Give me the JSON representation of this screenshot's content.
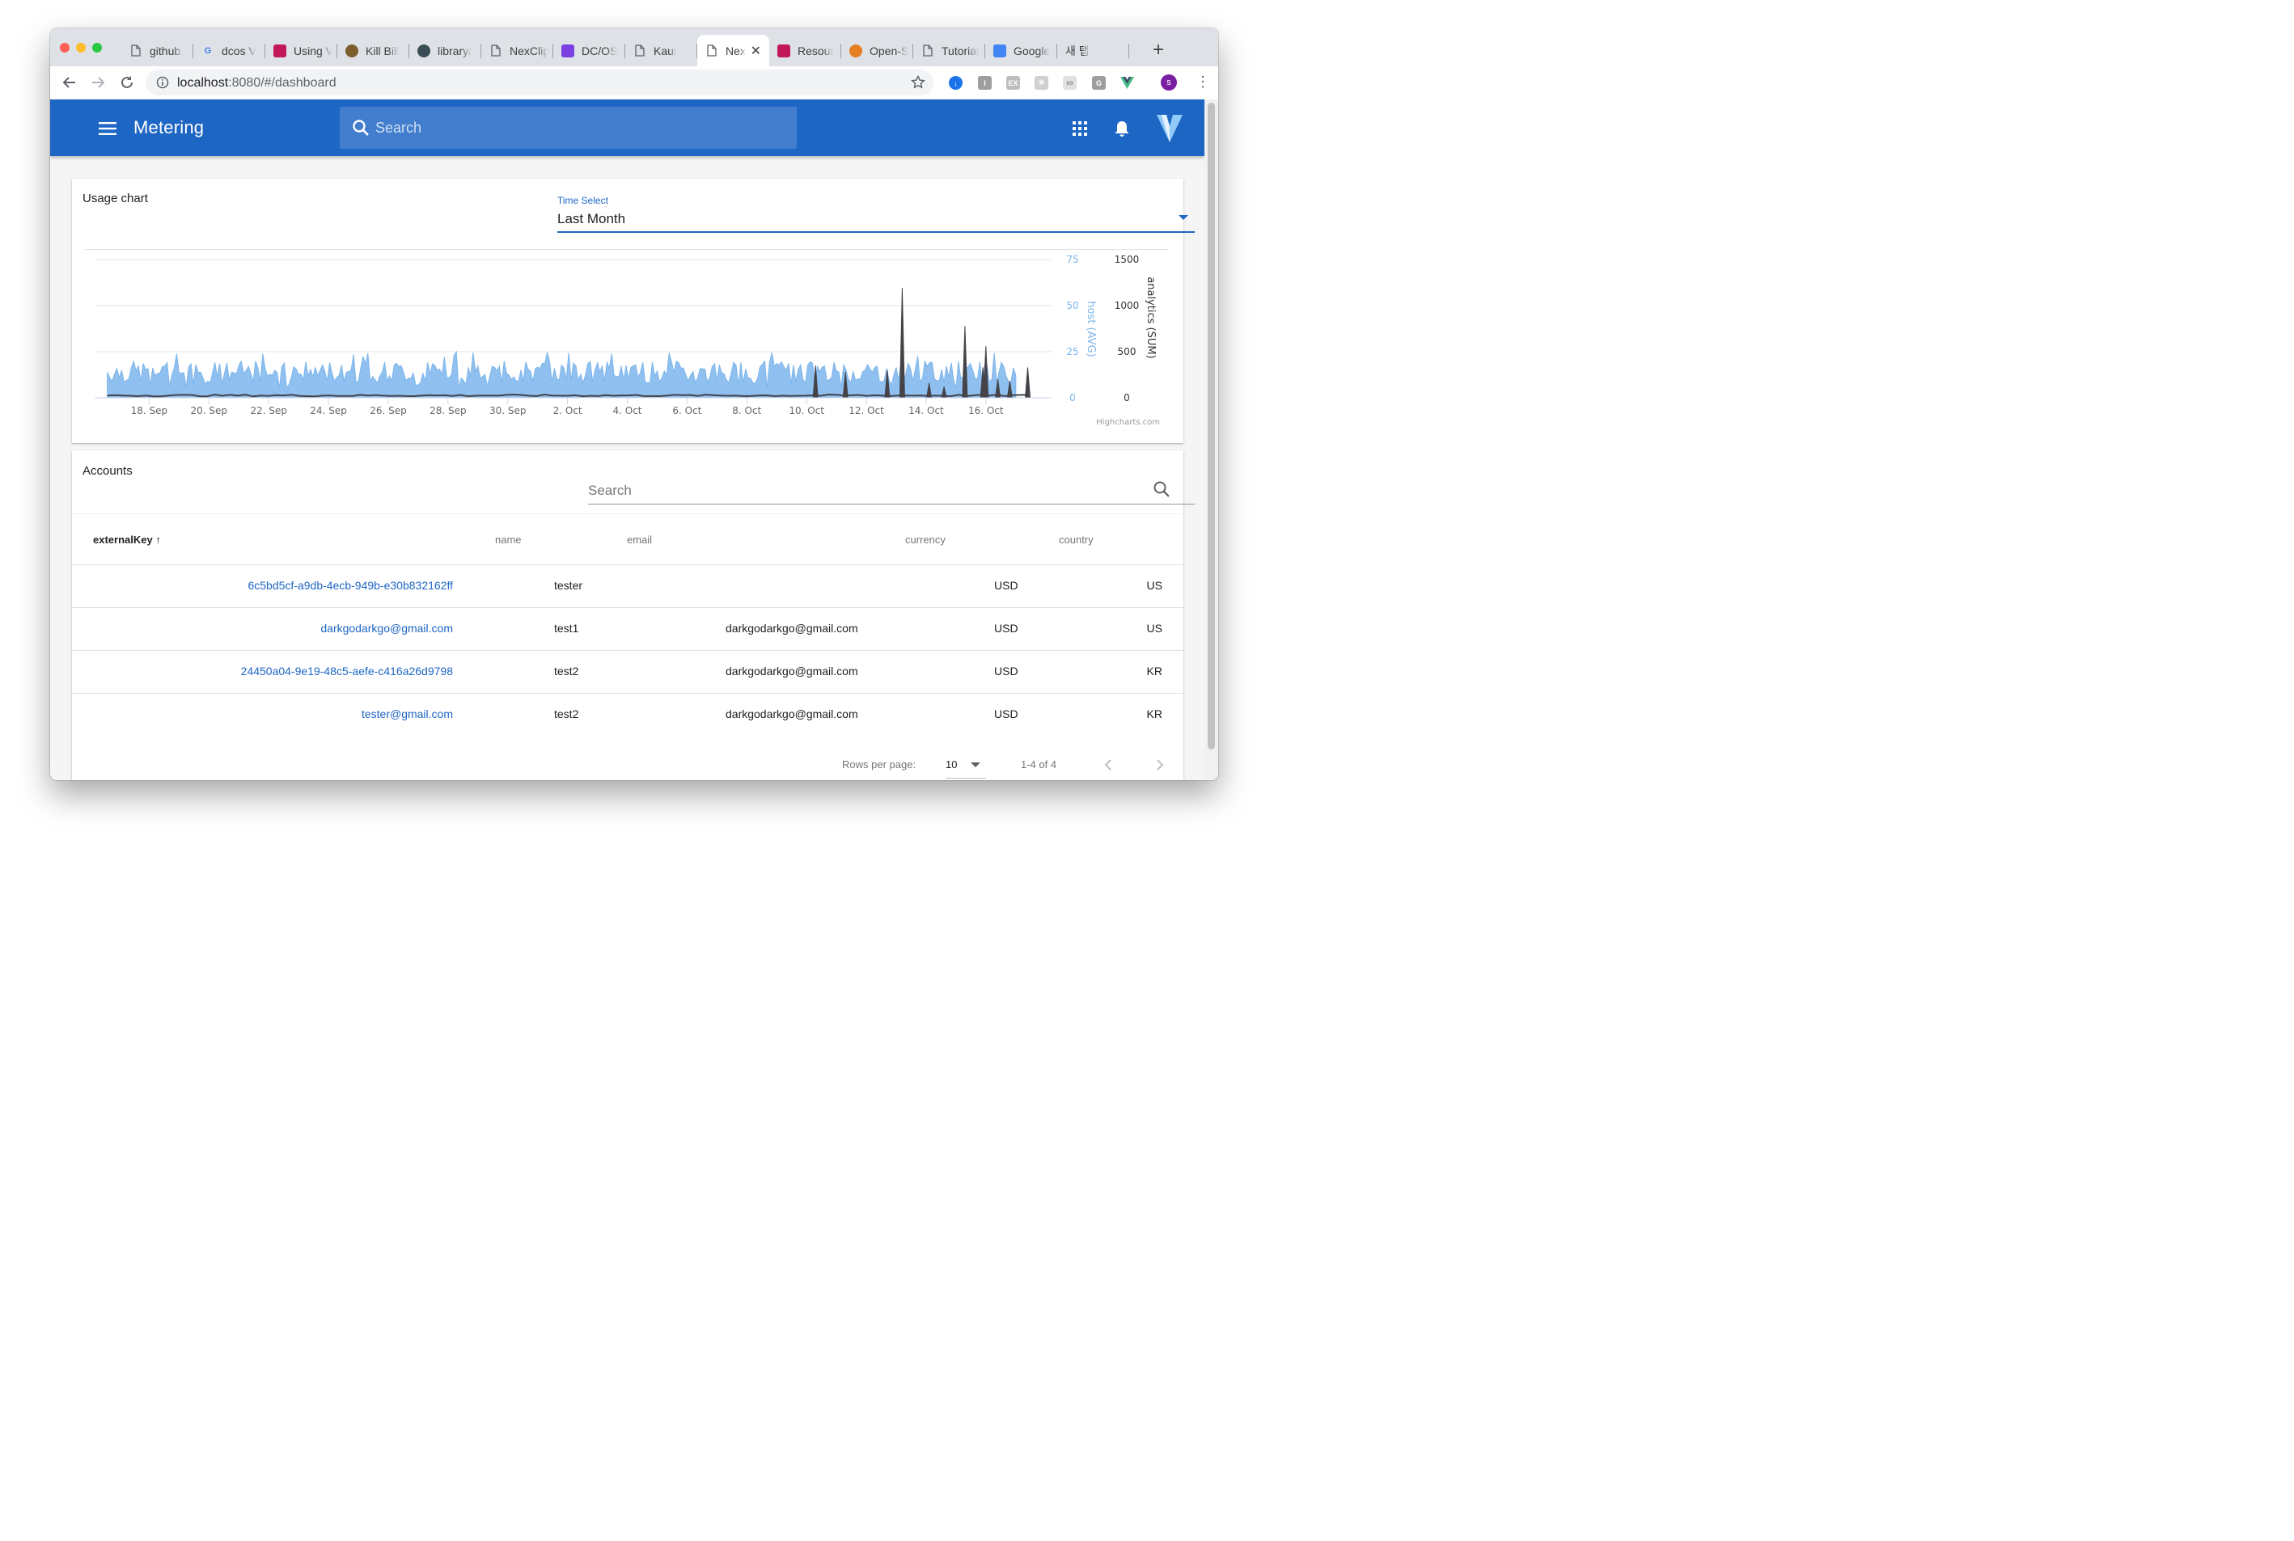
{
  "browser": {
    "tabs": [
      {
        "label": "github.",
        "icon": "doc-icon",
        "color": "#5f6368"
      },
      {
        "label": "dcos V",
        "icon": "google-icon",
        "color": "#4285f4"
      },
      {
        "label": "Using V",
        "icon": "app-icon",
        "color": "#c2185b"
      },
      {
        "label": "Kill Bill",
        "icon": "killbill-icon",
        "color": "#7b5e2b"
      },
      {
        "label": "library/",
        "icon": "docker-icon",
        "color": "#394d54"
      },
      {
        "label": "NexClip",
        "icon": "doc-icon",
        "color": "#5f6368"
      },
      {
        "label": "DC/OS",
        "icon": "dcos-icon",
        "color": "#7b3fe4"
      },
      {
        "label": "Kaui",
        "icon": "doc-icon",
        "color": "#5f6368"
      },
      {
        "label": "Nex",
        "icon": "doc-icon",
        "color": "#5f6368",
        "active": true
      },
      {
        "label": "Resour",
        "icon": "app-icon",
        "color": "#c2185b"
      },
      {
        "label": "Open-S",
        "icon": "globe-icon",
        "color": "#e67e22"
      },
      {
        "label": "Tutorial",
        "icon": "doc-icon",
        "color": "#5f6368"
      },
      {
        "label": "Google",
        "icon": "translate-icon",
        "color": "#4285f4"
      },
      {
        "label": "새 탭",
        "icon": "",
        "color": ""
      }
    ],
    "url_host": "localhost",
    "url_rest": ":8080/#/dashboard",
    "profile_initial": "s"
  },
  "appbar": {
    "title": "Metering",
    "search_placeholder": "Search"
  },
  "usage": {
    "title": "Usage chart",
    "select_label": "Time Select",
    "select_value": "Last Month",
    "credit": "Highcharts.com"
  },
  "chart_data": {
    "type": "area",
    "x_ticks": [
      "18. Sep",
      "20. Sep",
      "22. Sep",
      "24. Sep",
      "26. Sep",
      "28. Sep",
      "30. Sep",
      "2. Oct",
      "4. Oct",
      "6. Oct",
      "8. Oct",
      "10. Oct",
      "12. Oct",
      "14. Oct",
      "16. Oct"
    ],
    "x_range_days": [
      16.5,
      47.9
    ],
    "y_axes": [
      {
        "title": "host (AVG)",
        "ticks": [
          "75",
          "50",
          "25",
          "0"
        ],
        "range": [
          0,
          75
        ],
        "color": "#7cb5ec"
      },
      {
        "title": "analytics (SUM)",
        "ticks": [
          "1500",
          "1000",
          "500",
          "0"
        ],
        "range": [
          0,
          1500
        ],
        "color": "#434348"
      }
    ],
    "series": [
      {
        "name": "host (AVG)",
        "type": "area",
        "axis": 0,
        "color": "#7cb5ec",
        "typical_range": [
          8,
          20
        ],
        "max": 25
      },
      {
        "name": "analytics (SUM)",
        "type": "line",
        "axis": 1,
        "color": "#434348",
        "baseline": 25,
        "spikes": [
          {
            "day": 40.3,
            "value": 350
          },
          {
            "day": 41.3,
            "value": 280
          },
          {
            "day": 42.7,
            "value": 300
          },
          {
            "day": 43.2,
            "value": 1190
          },
          {
            "day": 44.1,
            "value": 160
          },
          {
            "day": 44.6,
            "value": 120
          },
          {
            "day": 45.3,
            "value": 780
          },
          {
            "day": 45.9,
            "value": 330
          },
          {
            "day": 46.0,
            "value": 560
          },
          {
            "day": 46.4,
            "value": 200
          },
          {
            "day": 46.8,
            "value": 180
          },
          {
            "day": 47.4,
            "value": 330
          }
        ]
      }
    ]
  },
  "accounts": {
    "title": "Accounts",
    "search_placeholder": "Search",
    "columns": {
      "externalKey": "externalKey",
      "name": "name",
      "email": "email",
      "currency": "currency",
      "country": "country"
    },
    "rows": [
      {
        "externalKey": "6c5bd5cf-a9db-4ecb-949b-e30b832162ff",
        "name": "tester",
        "email": "",
        "currency": "USD",
        "country": "US"
      },
      {
        "externalKey": "darkgodarkgo@gmail.com",
        "name": "test1",
        "email": "darkgodarkgo@gmail.com",
        "currency": "USD",
        "country": "US"
      },
      {
        "externalKey": "24450a04-9e19-48c5-aefe-c416a26d9798",
        "name": "test2",
        "email": "darkgodarkgo@gmail.com",
        "currency": "USD",
        "country": "KR"
      },
      {
        "externalKey": "tester@gmail.com",
        "name": "test2",
        "email": "darkgodarkgo@gmail.com",
        "currency": "USD",
        "country": "KR"
      }
    ],
    "rows_per_page_label": "Rows per page:",
    "rows_per_page_value": "10",
    "page_info": "1-4 of 4"
  },
  "colors": {
    "primary": "#1e66c4",
    "host_series": "#7cb5ec",
    "analytics_series": "#434348"
  }
}
